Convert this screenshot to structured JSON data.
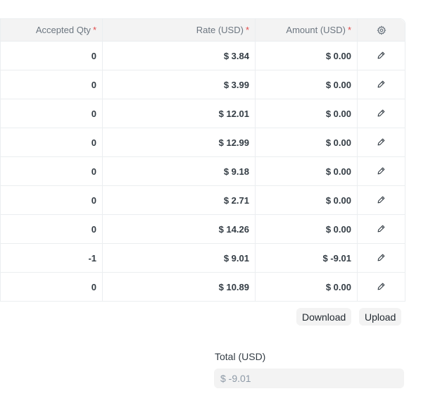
{
  "table": {
    "headers": {
      "accepted_qty": "Accepted Qty",
      "rate": "Rate (USD)",
      "amount": "Amount (USD)",
      "required_mark": "*"
    },
    "settings_icon": "gear-icon",
    "edit_icon": "pencil-icon",
    "rows": [
      {
        "accepted_qty": "0",
        "rate": "$ 3.84",
        "amount": "$ 0.00"
      },
      {
        "accepted_qty": "0",
        "rate": "$ 3.99",
        "amount": "$ 0.00"
      },
      {
        "accepted_qty": "0",
        "rate": "$ 12.01",
        "amount": "$ 0.00"
      },
      {
        "accepted_qty": "0",
        "rate": "$ 12.99",
        "amount": "$ 0.00"
      },
      {
        "accepted_qty": "0",
        "rate": "$ 9.18",
        "amount": "$ 0.00"
      },
      {
        "accepted_qty": "0",
        "rate": "$ 2.71",
        "amount": "$ 0.00"
      },
      {
        "accepted_qty": "0",
        "rate": "$ 14.26",
        "amount": "$ 0.00"
      },
      {
        "accepted_qty": "-1",
        "rate": "$ 9.01",
        "amount": "$ -9.01"
      },
      {
        "accepted_qty": "0",
        "rate": "$ 10.89",
        "amount": "$ 0.00"
      }
    ]
  },
  "actions": {
    "download_label": "Download",
    "upload_label": "Upload"
  },
  "total": {
    "label": "Total (USD)",
    "value": "$ -9.01"
  }
}
